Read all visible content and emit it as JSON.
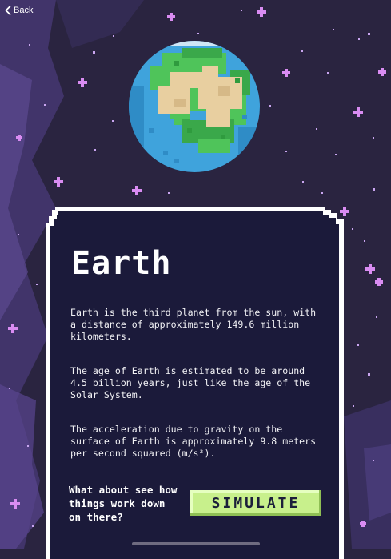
{
  "nav": {
    "back_label": "Back"
  },
  "planet": {
    "name": "Earth"
  },
  "card": {
    "title": "Earth",
    "paragraphs": [
      "Earth is the third planet from the sun, with a distance of approximately 149.6 million kilometers.",
      "The age of Earth is estimated to be around 4.5 billion years, just like the age of the Solar System.",
      "The acceleration due to gravity on the surface of Earth is approximately 9.8 meters per second squared (m/s²)."
    ],
    "question": "What about see how things work down on there?",
    "simulate_label": "SIMULATE"
  },
  "colors": {
    "background": "#2a2440",
    "card": "#1b1a3a",
    "accent_button": "#c8f08c",
    "star": "#d98cf2",
    "ocean": "#3fa3dc",
    "land_green": "#4fc45a",
    "land_sand": "#e8cfa0"
  },
  "icons": [
    "chevron-left-icon",
    "earth-planet-icon",
    "star-icon"
  ]
}
